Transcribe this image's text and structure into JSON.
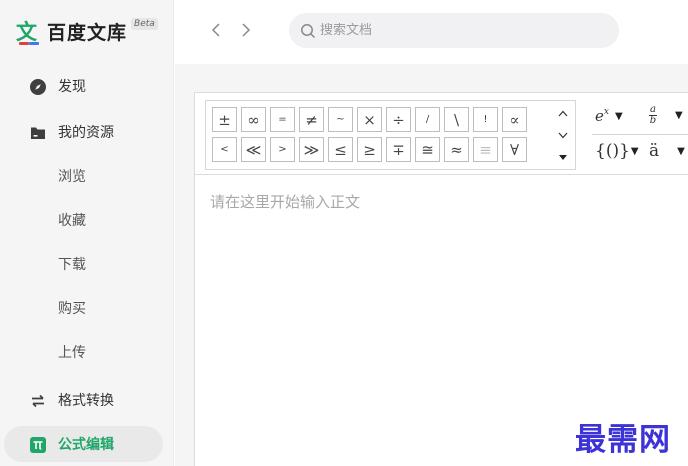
{
  "brand": {
    "name": "百度文库",
    "beta": "Beta",
    "logo_glyph": "文",
    "accent": "#21a66a"
  },
  "nav": {
    "discover": "发现",
    "my_resources": "我的资源",
    "browse": "浏览",
    "favorites": "收藏",
    "download": "下载",
    "purchase": "购买",
    "upload": "上传",
    "format_convert": "格式转换",
    "formula_edit": "公式编辑"
  },
  "search": {
    "placeholder": "搜索文档",
    "value": ""
  },
  "symbols": {
    "row1": [
      "±",
      "∞",
      "=",
      "≠",
      "~",
      "×",
      "÷",
      "/",
      "\\",
      "!",
      "∝"
    ],
    "row2": [
      "<",
      "≪",
      ">",
      "≫",
      "≤",
      "≥",
      "∓",
      "≅",
      "≈",
      "≡",
      "∀"
    ]
  },
  "templates": {
    "exp_base": "e",
    "exp_sup": "x",
    "frac_num": "a",
    "frac_den": "b",
    "brackets": "{()}",
    "accent": "ä"
  },
  "editor": {
    "placeholder": "请在这里开始输入正文"
  },
  "watermark": "最需网"
}
